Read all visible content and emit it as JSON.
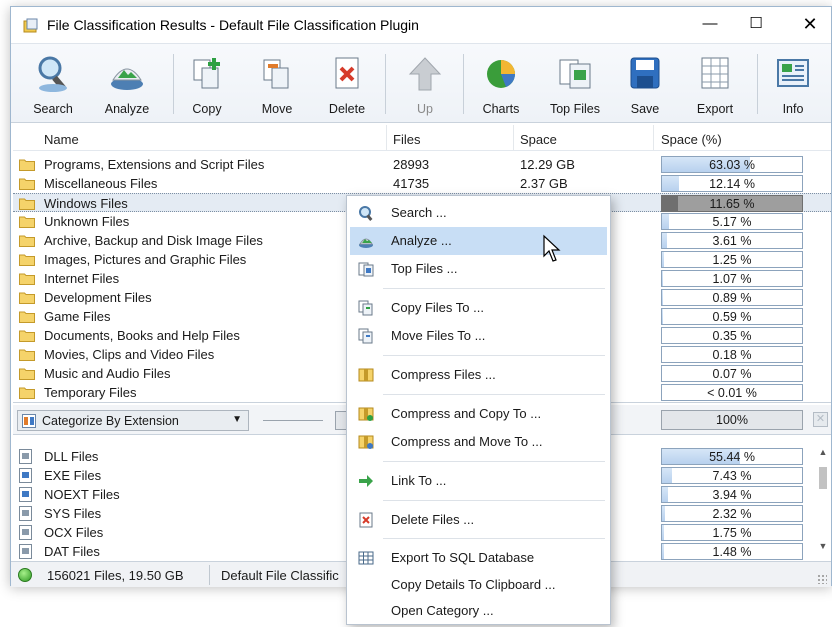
{
  "window": {
    "title": "File Classification Results - Default File Classification Plugin"
  },
  "window_controls": {
    "minimize": "—",
    "maximize": "☐",
    "close": "✕"
  },
  "toolbar": [
    {
      "label": "Search",
      "icon": "search-icon",
      "enabled": true
    },
    {
      "label": "Analyze",
      "icon": "analyze-icon",
      "enabled": true
    },
    {
      "label": "Copy",
      "icon": "copy-icon",
      "enabled": true
    },
    {
      "label": "Move",
      "icon": "move-icon",
      "enabled": true
    },
    {
      "label": "Delete",
      "icon": "delete-icon",
      "enabled": true
    },
    {
      "label": "Up",
      "icon": "up-arrow-icon",
      "enabled": false
    },
    {
      "label": "Charts",
      "icon": "pie-chart-icon",
      "enabled": true
    },
    {
      "label": "Top Files",
      "icon": "top-files-icon",
      "enabled": true
    },
    {
      "label": "Save",
      "icon": "save-disk-icon",
      "enabled": true
    },
    {
      "label": "Export",
      "icon": "export-grid-icon",
      "enabled": true
    },
    {
      "label": "Info",
      "icon": "info-icon",
      "enabled": true
    }
  ],
  "grid": {
    "columns": {
      "name": "Name",
      "files": "Files",
      "space": "Space",
      "space_pct": "Space (%)"
    },
    "rows": [
      {
        "name": "Programs, Extensions and Script Files",
        "files": "28993",
        "space": "12.29 GB",
        "pct_label": "63.03 %",
        "pct": 63.03
      },
      {
        "name": "Miscellaneous Files",
        "files": "41735",
        "space": "2.37 GB",
        "pct_label": "12.14 %",
        "pct": 12.14
      },
      {
        "name": "Windows Files",
        "files": "",
        "space": "",
        "pct_label": "11.65 %",
        "pct": 11.65,
        "selected": true
      },
      {
        "name": "Unknown Files",
        "files": "",
        "space": "",
        "pct_label": "5.17 %",
        "pct": 5.17
      },
      {
        "name": "Archive, Backup and Disk Image Files",
        "files": "",
        "space": "",
        "pct_label": "3.61 %",
        "pct": 3.61
      },
      {
        "name": "Images, Pictures and Graphic Files",
        "files": "",
        "space": "",
        "pct_label": "1.25 %",
        "pct": 1.25
      },
      {
        "name": "Internet Files",
        "files": "",
        "space": "",
        "pct_label": "1.07 %",
        "pct": 1.07
      },
      {
        "name": "Development Files",
        "files": "",
        "space": "",
        "pct_label": "0.89 %",
        "pct": 0.89
      },
      {
        "name": "Game Files",
        "files": "",
        "space": "",
        "pct_label": "0.59 %",
        "pct": 0.59
      },
      {
        "name": "Documents, Books and Help Files",
        "files": "",
        "space": "",
        "pct_label": "0.35 %",
        "pct": 0.35
      },
      {
        "name": "Movies, Clips and Video Files",
        "files": "",
        "space": "",
        "pct_label": "0.18 %",
        "pct": 0.18
      },
      {
        "name": "Music and Audio Files",
        "files": "",
        "space": "",
        "pct_label": "0.07 %",
        "pct": 0.07
      },
      {
        "name": "Temporary Files",
        "files": "",
        "space": "",
        "pct_label": "< 0.01 %",
        "pct": 0.01
      }
    ]
  },
  "midbar": {
    "categorize": "Categorize By Extension",
    "total_pct": "100%"
  },
  "grid2": {
    "rows": [
      {
        "name": "DLL Files",
        "pct_label": "55.44 %",
        "pct": 55.44
      },
      {
        "name": "EXE Files",
        "pct_label": "7.43 %",
        "pct": 7.43
      },
      {
        "name": "NOEXT Files",
        "pct_label": "3.94 %",
        "pct": 3.94
      },
      {
        "name": "SYS Files",
        "pct_label": "2.32 %",
        "pct": 2.32
      },
      {
        "name": "OCX Files",
        "pct_label": "1.75 %",
        "pct": 1.75
      },
      {
        "name": "DAT Files",
        "pct_label": "1.48 %",
        "pct": 1.48
      }
    ]
  },
  "status": {
    "summary": "156021 Files, 19.50 GB",
    "plugin": "Default File Classific"
  },
  "context_menu": [
    {
      "label": "Search ...",
      "icon": "search-icon"
    },
    {
      "label": "Analyze ...",
      "icon": "analyze-icon",
      "highlighted": true
    },
    {
      "label": "Top Files ...",
      "icon": "top-files-icon"
    },
    {
      "label": "Copy Files To ...",
      "icon": "copy-icon"
    },
    {
      "label": "Move Files To ...",
      "icon": "move-icon"
    },
    {
      "label": "Compress Files ...",
      "icon": "compress-icon"
    },
    {
      "label": "Compress and Copy To ...",
      "icon": "compress-copy-icon"
    },
    {
      "label": "Compress and Move To ...",
      "icon": "compress-move-icon"
    },
    {
      "label": "Link To ...",
      "icon": "link-arrow-icon"
    },
    {
      "label": "Delete Files ...",
      "icon": "delete-icon"
    },
    {
      "label": "Export To SQL Database",
      "icon": "database-grid-icon"
    },
    {
      "label": "Copy Details To Clipboard ...",
      "icon": ""
    },
    {
      "label": "Open Category ...",
      "icon": ""
    }
  ],
  "colors": {
    "bar_fill": "#b8d1ee",
    "selection": "#e4ebf3",
    "menu_highlight": "#c8def5",
    "folder": "#f2c94c"
  }
}
